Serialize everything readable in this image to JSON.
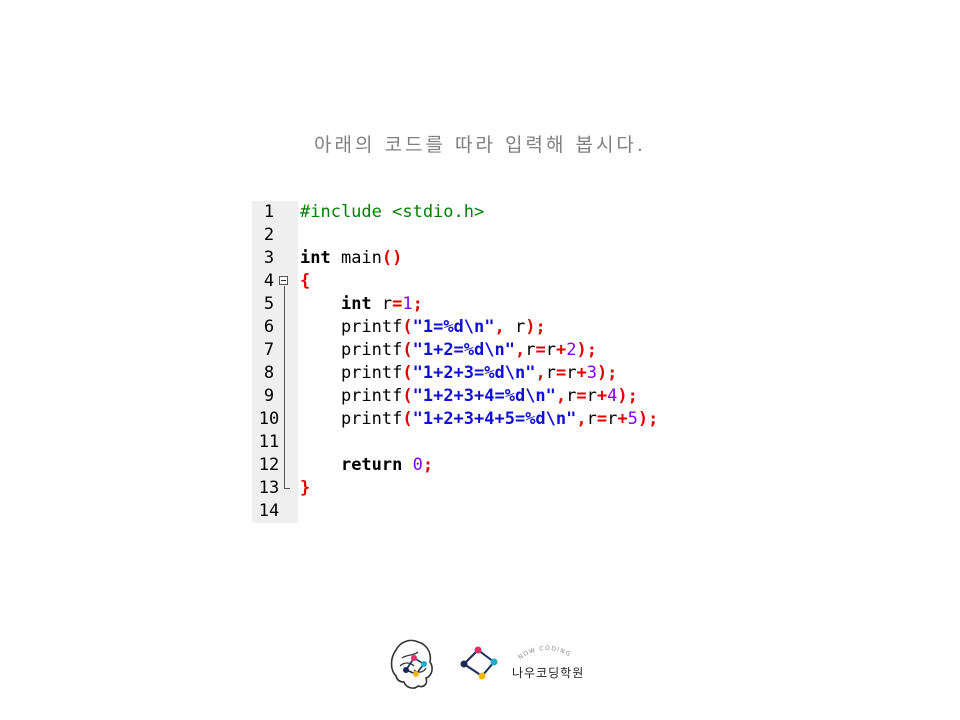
{
  "instruction": "아래의 코드를 따라 입력해 봅시다.",
  "code_lines": [
    {
      "no": "1",
      "tokens": [
        {
          "t": "#include <stdio.h>",
          "c": "pp"
        }
      ]
    },
    {
      "no": "2",
      "tokens": []
    },
    {
      "no": "3",
      "tokens": [
        {
          "t": "int",
          "c": "kw"
        },
        {
          "t": " main",
          "c": "id"
        },
        {
          "t": "()",
          "c": "op"
        }
      ]
    },
    {
      "no": "4",
      "tokens": [
        {
          "t": "{",
          "c": "op"
        }
      ]
    },
    {
      "no": "5",
      "tokens": [
        {
          "t": "    ",
          "c": "id"
        },
        {
          "t": "int",
          "c": "kw"
        },
        {
          "t": " r",
          "c": "id"
        },
        {
          "t": "=",
          "c": "op"
        },
        {
          "t": "1",
          "c": "num"
        },
        {
          "t": ";",
          "c": "op"
        }
      ]
    },
    {
      "no": "6",
      "tokens": [
        {
          "t": "    printf",
          "c": "id"
        },
        {
          "t": "(",
          "c": "op"
        },
        {
          "t": "\"1=%d\\n\"",
          "c": "str"
        },
        {
          "t": ",",
          "c": "op"
        },
        {
          "t": " r",
          "c": "id"
        },
        {
          "t": ");",
          "c": "op"
        }
      ]
    },
    {
      "no": "7",
      "tokens": [
        {
          "t": "    printf",
          "c": "id"
        },
        {
          "t": "(",
          "c": "op"
        },
        {
          "t": "\"1+2=%d\\n\"",
          "c": "str"
        },
        {
          "t": ",",
          "c": "op"
        },
        {
          "t": "r",
          "c": "id"
        },
        {
          "t": "=",
          "c": "op"
        },
        {
          "t": "r",
          "c": "id"
        },
        {
          "t": "+",
          "c": "op"
        },
        {
          "t": "2",
          "c": "num"
        },
        {
          "t": ");",
          "c": "op"
        }
      ]
    },
    {
      "no": "8",
      "tokens": [
        {
          "t": "    printf",
          "c": "id"
        },
        {
          "t": "(",
          "c": "op"
        },
        {
          "t": "\"1+2+3=%d\\n\"",
          "c": "str"
        },
        {
          "t": ",",
          "c": "op"
        },
        {
          "t": "r",
          "c": "id"
        },
        {
          "t": "=",
          "c": "op"
        },
        {
          "t": "r",
          "c": "id"
        },
        {
          "t": "+",
          "c": "op"
        },
        {
          "t": "3",
          "c": "num"
        },
        {
          "t": ");",
          "c": "op"
        }
      ]
    },
    {
      "no": "9",
      "tokens": [
        {
          "t": "    printf",
          "c": "id"
        },
        {
          "t": "(",
          "c": "op"
        },
        {
          "t": "\"1+2+3+4=%d\\n\"",
          "c": "str"
        },
        {
          "t": ",",
          "c": "op"
        },
        {
          "t": "r",
          "c": "id"
        },
        {
          "t": "=",
          "c": "op"
        },
        {
          "t": "r",
          "c": "id"
        },
        {
          "t": "+",
          "c": "op"
        },
        {
          "t": "4",
          "c": "num"
        },
        {
          "t": ");",
          "c": "op"
        }
      ]
    },
    {
      "no": "10",
      "tokens": [
        {
          "t": "    printf",
          "c": "id"
        },
        {
          "t": "(",
          "c": "op"
        },
        {
          "t": "\"1+2+3+4+5=%d\\n\"",
          "c": "str"
        },
        {
          "t": ",",
          "c": "op"
        },
        {
          "t": "r",
          "c": "id"
        },
        {
          "t": "=",
          "c": "op"
        },
        {
          "t": "r",
          "c": "id"
        },
        {
          "t": "+",
          "c": "op"
        },
        {
          "t": "5",
          "c": "num"
        },
        {
          "t": ");",
          "c": "op"
        }
      ]
    },
    {
      "no": "11",
      "tokens": []
    },
    {
      "no": "12",
      "tokens": [
        {
          "t": "    ",
          "c": "id"
        },
        {
          "t": "return",
          "c": "kw"
        },
        {
          "t": " ",
          "c": "id"
        },
        {
          "t": "0",
          "c": "num"
        },
        {
          "t": ";",
          "c": "op"
        }
      ]
    },
    {
      "no": "13",
      "tokens": [
        {
          "t": "}",
          "c": "op"
        }
      ]
    },
    {
      "no": "14",
      "tokens": []
    }
  ],
  "brand": {
    "name": "나우코딩학원",
    "arc_text": "NOW CODING",
    "icon_colors": [
      "#e0306a",
      "#f5b800",
      "#18b0c8",
      "#1a2a5a"
    ]
  }
}
